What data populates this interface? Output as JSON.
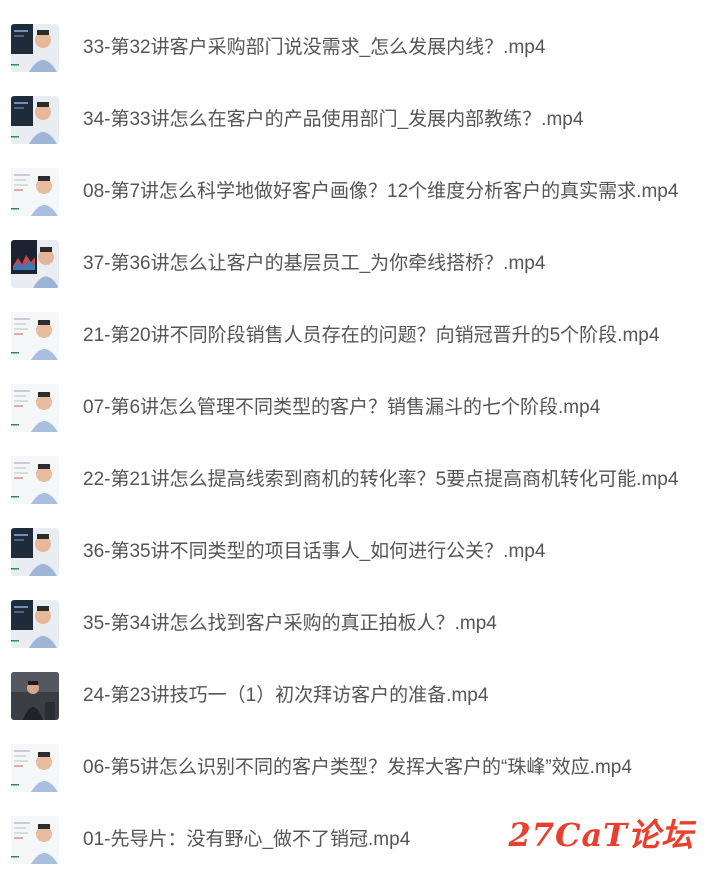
{
  "files": [
    {
      "name": "33-第32讲客户采购部门说没需求_怎么发展内线？.mp4",
      "thumb": "dark-slide"
    },
    {
      "name": "34-第33讲怎么在客户的产品使用部门_发展内部教练？.mp4",
      "thumb": "dark-slide"
    },
    {
      "name": "08-第7讲怎么科学地做好客户画像？12个维度分析客户的真实需求.mp4",
      "thumb": "light-slide"
    },
    {
      "name": "37-第36讲怎么让客户的基层员工_为你牵线搭桥？.mp4",
      "thumb": "dark-chart"
    },
    {
      "name": "21-第20讲不同阶段销售人员存在的问题？向销冠晋升的5个阶段.mp4",
      "thumb": "light-slide"
    },
    {
      "name": "07-第6讲怎么管理不同类型的客户？销售漏斗的七个阶段.mp4",
      "thumb": "light-slide"
    },
    {
      "name": "22-第21讲怎么提高线索到商机的转化率？5要点提高商机转化可能.mp4",
      "thumb": "light-slide"
    },
    {
      "name": "36-第35讲不同类型的项目话事人_如何进行公关？.mp4",
      "thumb": "dark-slide"
    },
    {
      "name": "35-第34讲怎么找到客户采购的真正拍板人？.mp4",
      "thumb": "dark-slide"
    },
    {
      "name": "24-第23讲技巧一（1）初次拜访客户的准备.mp4",
      "thumb": "stage"
    },
    {
      "name": "06-第5讲怎么识别不同的客户类型？发挥大客户的“珠峰”效应.mp4",
      "thumb": "light-slide"
    },
    {
      "name": "01-先导片：没有野心_做不了销冠.mp4",
      "thumb": "light-slide"
    }
  ],
  "watermark": "27CaT论坛",
  "colors": {
    "text": "#555555",
    "watermark": "#e8402c"
  }
}
